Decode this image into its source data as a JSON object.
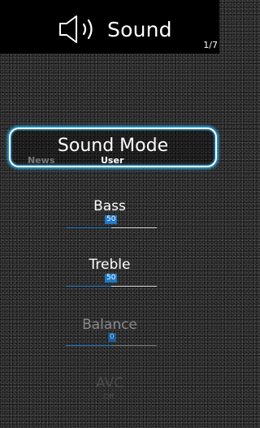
{
  "header": {
    "title": "Sound",
    "page_indicator": "1/7",
    "icon": "speaker-icon"
  },
  "sound_mode": {
    "label": "Sound Mode",
    "prev_option": "News",
    "selected_option": "User"
  },
  "settings": {
    "bass": {
      "label": "Bass",
      "value": "50",
      "level": 0.5
    },
    "treble": {
      "label": "Treble",
      "value": "50",
      "level": 0.5
    },
    "balance": {
      "label": "Balance",
      "value": "0",
      "level": 0.5
    },
    "avc": {
      "label": "AVC",
      "value": "Off"
    }
  },
  "colors": {
    "accent": "#1e78c8",
    "focus_glow": "#2aa7e0",
    "header_bg": "#000000"
  }
}
